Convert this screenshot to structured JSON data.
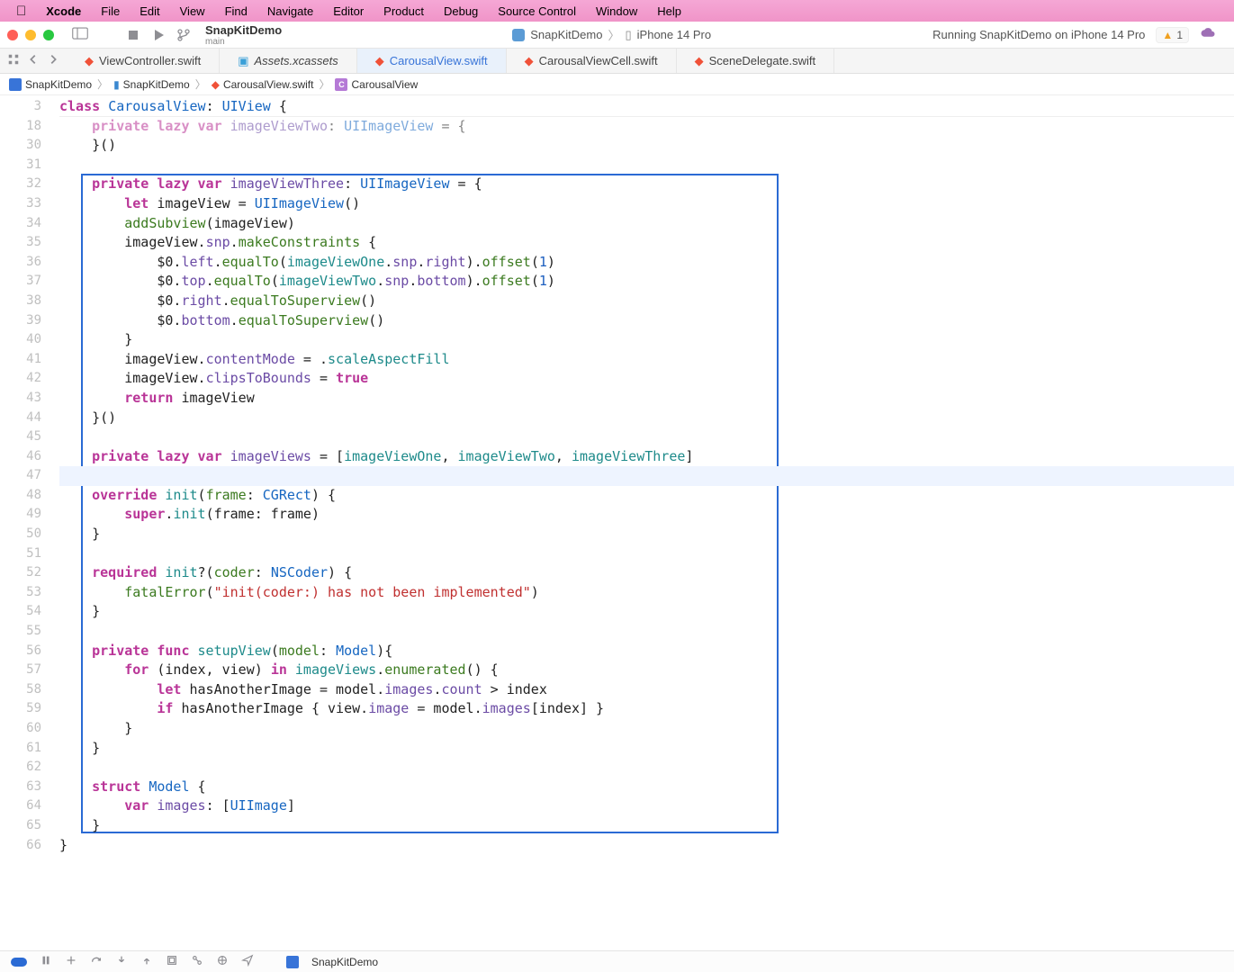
{
  "menubar": {
    "appname": "Xcode",
    "items": [
      "File",
      "Edit",
      "View",
      "Find",
      "Navigate",
      "Editor",
      "Product",
      "Debug",
      "Source Control",
      "Window",
      "Help"
    ]
  },
  "toolbar": {
    "scheme_name": "SnapKitDemo",
    "scheme_branch": "main",
    "center_app": "SnapKitDemo",
    "center_device": "iPhone 14 Pro",
    "status": "Running SnapKitDemo on iPhone 14 Pro",
    "warning_count": "1"
  },
  "tabs": [
    {
      "label": "ViewController.swift",
      "icon": "swift"
    },
    {
      "label": "Assets.xcassets",
      "icon": "assets"
    },
    {
      "label": "CarousalView.swift",
      "icon": "swift",
      "active": true
    },
    {
      "label": "CarousalViewCell.swift",
      "icon": "swift"
    },
    {
      "label": "SceneDelegate.swift",
      "icon": "swift"
    }
  ],
  "breadcrumb": {
    "project": "SnapKitDemo",
    "folder": "SnapKitDemo",
    "file": "CarousalView.swift",
    "symbol": "CarousalView"
  },
  "editor": {
    "sticky_line_no": "3",
    "faded_line_no": "18",
    "lines": [
      {
        "no": "30",
        "html": "    }()",
        "cls": ""
      },
      {
        "no": "31",
        "html": "",
        "cls": ""
      },
      {
        "no": "32",
        "html": "    <span class='kw'>private</span> <span class='kw'>lazy</span> <span class='kw'>var</span> <span class='prop'>imageViewThree</span>: <span class='type'>UIImageView</span> = {",
        "cls": ""
      },
      {
        "no": "33",
        "html": "        <span class='kw'>let</span> imageView = <span class='type'>UIImageView</span>()",
        "cls": ""
      },
      {
        "no": "34",
        "html": "        <span class='fn'>addSubview</span>(imageView)",
        "cls": ""
      },
      {
        "no": "35",
        "html": "        imageView.<span class='prop'>snp</span>.<span class='fn'>makeConstraints</span> {",
        "cls": ""
      },
      {
        "no": "36",
        "html": "            $0.<span class='prop'>left</span>.<span class='fn'>equalTo</span>(<span class='teal'>imageViewOne</span>.<span class='prop'>snp</span>.<span class='prop'>right</span>).<span class='fn'>offset</span>(<span class='num'>1</span>)",
        "cls": ""
      },
      {
        "no": "37",
        "html": "            $0.<span class='prop'>top</span>.<span class='fn'>equalTo</span>(<span class='teal'>imageViewTwo</span>.<span class='prop'>snp</span>.<span class='prop'>bottom</span>).<span class='fn'>offset</span>(<span class='num'>1</span>)",
        "cls": ""
      },
      {
        "no": "38",
        "html": "            $0.<span class='prop'>right</span>.<span class='fn'>equalToSuperview</span>()",
        "cls": ""
      },
      {
        "no": "39",
        "html": "            $0.<span class='prop'>bottom</span>.<span class='fn'>equalToSuperview</span>()",
        "cls": ""
      },
      {
        "no": "40",
        "html": "        }",
        "cls": ""
      },
      {
        "no": "41",
        "html": "        imageView.<span class='prop'>contentMode</span> = .<span class='teal'>scaleAspectFill</span>",
        "cls": ""
      },
      {
        "no": "42",
        "html": "        imageView.<span class='prop'>clipsToBounds</span> = <span class='kw'>true</span>",
        "cls": ""
      },
      {
        "no": "43",
        "html": "        <span class='kw'>return</span> imageView",
        "cls": ""
      },
      {
        "no": "44",
        "html": "    }()",
        "cls": ""
      },
      {
        "no": "45",
        "html": "",
        "cls": ""
      },
      {
        "no": "46",
        "html": "    <span class='kw'>private</span> <span class='kw'>lazy</span> <span class='kw'>var</span> <span class='prop'>imageViews</span> = [<span class='teal'>imageViewOne</span>, <span class='teal'>imageViewTwo</span>, <span class='teal'>imageViewThree</span>]",
        "cls": ""
      },
      {
        "no": "47",
        "html": "",
        "cls": "cursor-row"
      },
      {
        "no": "48",
        "html": "    <span class='kw'>override</span> <span class='teal'>init</span>(<span class='fn'>frame</span>: <span class='type'>CGRect</span>) {",
        "cls": ""
      },
      {
        "no": "49",
        "html": "        <span class='kw'>super</span>.<span class='teal'>init</span>(frame: frame)",
        "cls": ""
      },
      {
        "no": "50",
        "html": "    }",
        "cls": ""
      },
      {
        "no": "51",
        "html": "",
        "cls": ""
      },
      {
        "no": "52",
        "html": "    <span class='kw'>required</span> <span class='teal'>init</span>?(<span class='fn'>coder</span>: <span class='type'>NSCoder</span>) {",
        "cls": ""
      },
      {
        "no": "53",
        "html": "        <span class='fn'>fatalError</span>(<span class='str'>\"init(coder:) has not been implemented\"</span>)",
        "cls": ""
      },
      {
        "no": "54",
        "html": "    }",
        "cls": ""
      },
      {
        "no": "55",
        "html": "",
        "cls": ""
      },
      {
        "no": "56",
        "html": "    <span class='kw'>private</span> <span class='kw'>func</span> <span class='teal'>setupView</span>(<span class='fn'>model</span>: <span class='type'>Model</span>){",
        "cls": ""
      },
      {
        "no": "57",
        "html": "        <span class='kw'>for</span> (index, view) <span class='kw'>in</span> <span class='teal'>imageViews</span>.<span class='fn'>enumerated</span>() {",
        "cls": ""
      },
      {
        "no": "58",
        "html": "            <span class='kw'>let</span> hasAnotherImage = model.<span class='prop'>images</span>.<span class='prop'>count</span> &gt; index",
        "cls": ""
      },
      {
        "no": "59",
        "html": "            <span class='kw'>if</span> hasAnotherImage { view.<span class='prop'>image</span> = model.<span class='prop'>images</span>[index] }",
        "cls": ""
      },
      {
        "no": "60",
        "html": "        }",
        "cls": ""
      },
      {
        "no": "61",
        "html": "    }",
        "cls": ""
      },
      {
        "no": "62",
        "html": "",
        "cls": ""
      },
      {
        "no": "63",
        "html": "    <span class='kw'>struct</span> <span class='type'>Model</span> {",
        "cls": ""
      },
      {
        "no": "64",
        "html": "        <span class='kw'>var</span> <span class='prop'>images</span>: [<span class='type'>UIImage</span>]",
        "cls": ""
      },
      {
        "no": "65",
        "html": "    }",
        "cls": ""
      },
      {
        "no": "66",
        "html": "}",
        "cls": ""
      }
    ],
    "sticky_html": "<span class='kw'>class</span> <span class='type'>CarousalView</span>: <span class='type'>UIView</span> {",
    "faded_html": "    <span class='kw'>private</span> <span class='kw'>lazy</span> <span class='kw'>var</span> <span class='prop'>imageViewTwo</span>: <span class='type'>UIImageView</span> = {"
  },
  "debugbar": {
    "project": "SnapKitDemo"
  }
}
